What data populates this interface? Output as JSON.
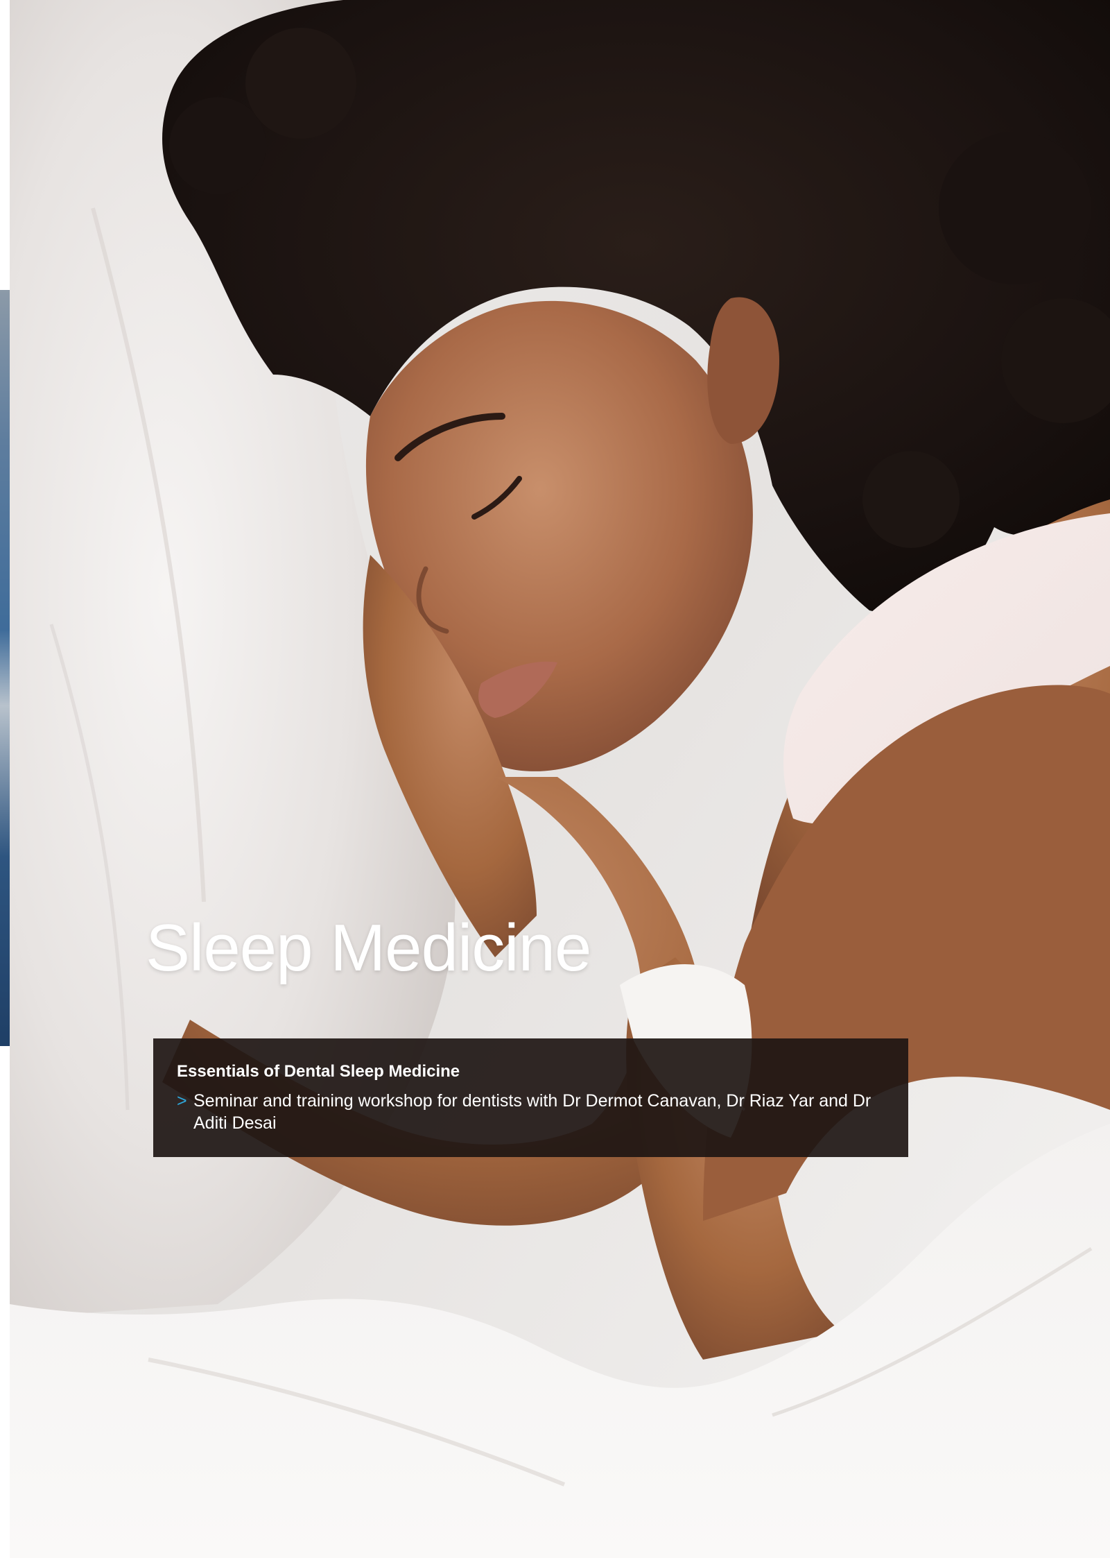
{
  "page": {
    "title": "Sleep Medicine"
  },
  "course": {
    "heading": "Essentials of Dental Sleep Medicine",
    "bullet_glyph": ">",
    "description": "Seminar and training workshop for dentists with Dr Dermot Canavan, Dr Riaz Yar and Dr Aditi Desai"
  },
  "colors": {
    "bullet_accent": "#2fa8dc",
    "box_background": "#1e1614",
    "title_text": "#ffffff"
  },
  "images": {
    "hero": "woman-sleeping-on-pillow-photo",
    "left_edge": "adjacent-page-photo-edge"
  }
}
